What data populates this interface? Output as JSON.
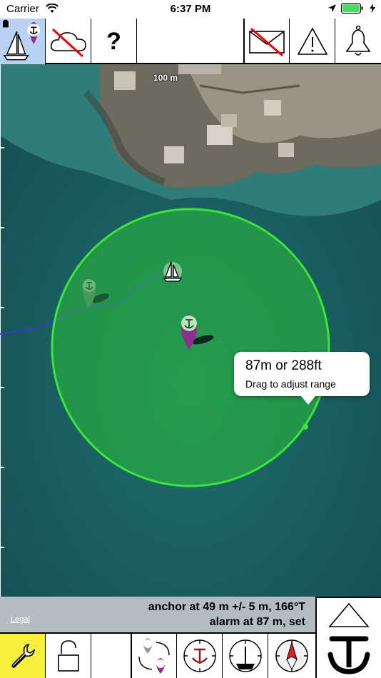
{
  "status_bar": {
    "carrier": "Carrier",
    "time": "6:37 PM"
  },
  "top_toolbar": {
    "help_label": "?"
  },
  "map": {
    "scale_label": "100 m",
    "range_tooltip": {
      "title": "87m or 288ft",
      "subtitle": "Drag to adjust range"
    },
    "legal_label": "Legal"
  },
  "info": {
    "line1": "anchor at 49 m +/- 5 m, 166°T",
    "line2": "alarm at 87 m, set"
  },
  "colors": {
    "range_circle": "#39e639",
    "anchor_pin": "#8e2e8e",
    "track": "#3a3ad0",
    "selected_tab": "#b9d2f4",
    "settings_bg": "#f7ef3b",
    "info_panel": "#b3bcc1"
  }
}
